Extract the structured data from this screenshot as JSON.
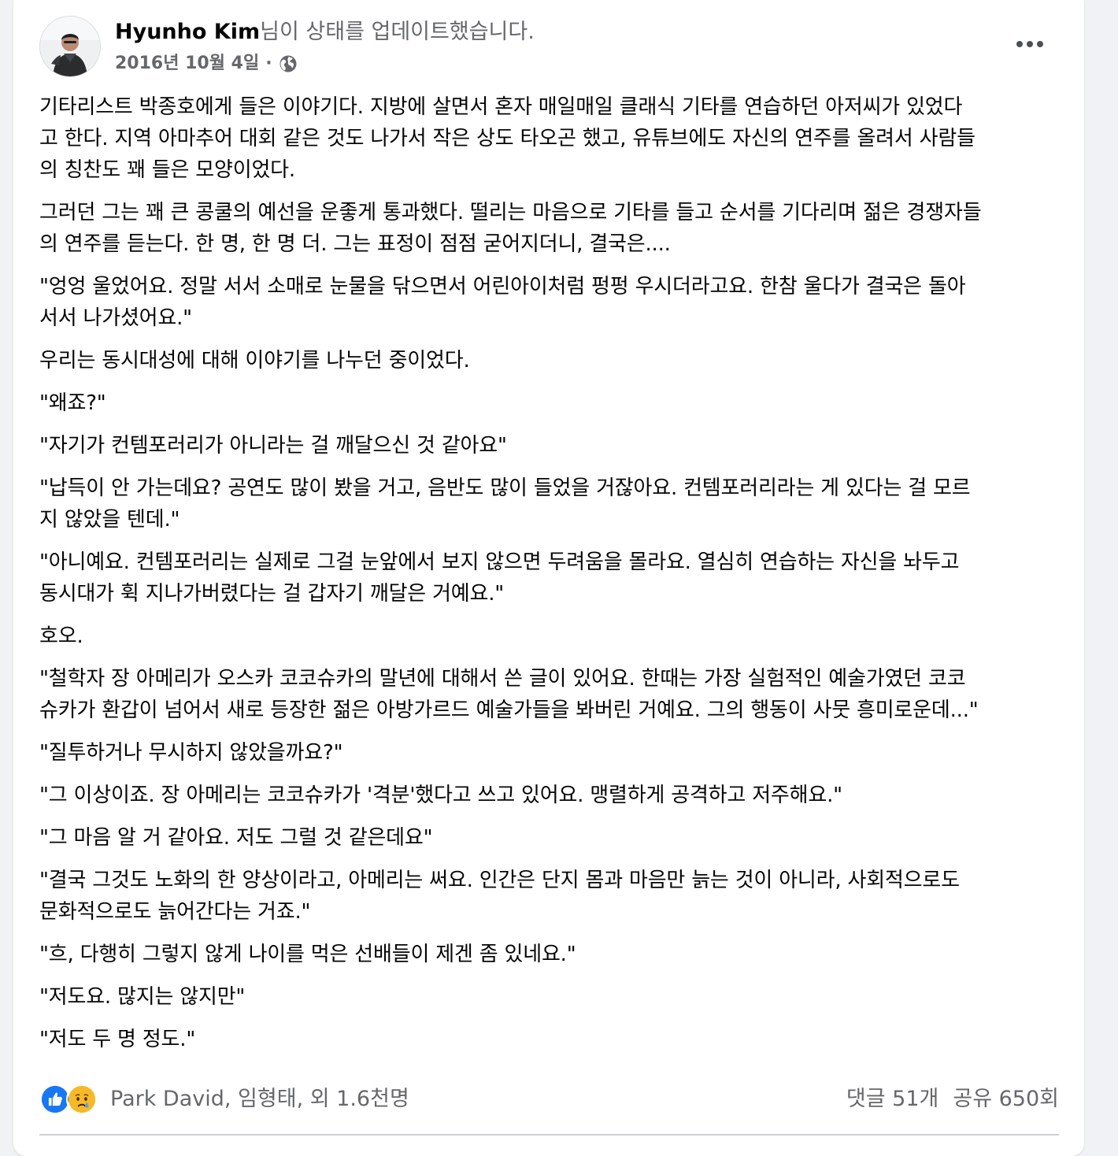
{
  "post": {
    "author": "Hyunho Kim",
    "action": "님이 상태를 업데이트했습니다.",
    "date": "2016년 10월 4일",
    "separator": "·",
    "privacy_icon": "globe-icon",
    "more_icon": "more-options-icon",
    "paragraphs": [
      [
        "기타리스트 박종호에게 들은 이야기다. 지방에 살면서 혼자 매일매일 클래식 기타를 연습하던 아저씨가 있었다",
        "고 한다. 지역 아마추어 대회 같은 것도 나가서 작은 상도 타오곤 했고, 유튜브에도 자신의 연주를 올려서 사람들",
        "의 칭찬도 꽤 들은 모양이었다."
      ],
      [
        "그러던 그는 꽤 큰 콩쿨의 예선을 운좋게 통과했다. 떨리는 마음으로 기타를 들고 순서를 기다리며 젊은 경쟁자들",
        "의 연주를 듣는다. 한 명, 한 명 더. 그는 표정이 점점 굳어지더니, 결국은...."
      ],
      [
        "\"엉엉 울었어요. 정말 서서 소매로 눈물을 닦으면서 어린아이처럼 펑펑 우시더라고요. 한참 울다가 결국은 돌아",
        "서서 나가셨어요.\""
      ],
      [
        "우리는 동시대성에 대해 이야기를 나누던 중이었다."
      ],
      [
        "\"왜죠?\""
      ],
      [
        "\"자기가 컨템포러리가 아니라는 걸 깨달으신 것 같아요\""
      ],
      [
        "\"납득이 안 가는데요? 공연도 많이 봤을 거고, 음반도 많이 들었을 거잖아요. 컨템포러리라는 게 있다는 걸 모르",
        "지 않았을 텐데.\""
      ],
      [
        "\"아니예요. 컨템포러리는 실제로 그걸 눈앞에서 보지 않으면 두려움을 몰라요. 열심히 연습하는 자신을 놔두고",
        "동시대가 휙 지나가버렸다는 걸 갑자기 깨달은 거예요.\""
      ],
      [
        "호오."
      ],
      [
        "\"철학자 장 아메리가 오스카 코코슈카의 말년에 대해서 쓴 글이 있어요. 한때는 가장 실험적인 예술가였던 코코",
        "슈카가 환갑이 넘어서 새로 등장한 젊은 아방가르드 예술가들을 봐버린 거예요. 그의 행동이 사뭇 흥미로운데...\""
      ],
      [
        "\"질투하거나 무시하지 않았을까요?\""
      ],
      [
        "\"그 이상이죠. 장 아메리는 코코슈카가 '격분'했다고 쓰고 있어요. 맹렬하게 공격하고 저주해요.\""
      ],
      [
        "\"그 마음 알 거 같아요. 저도 그럴 것 같은데요\""
      ],
      [
        "\"결국 그것도 노화의 한 양상이라고, 아메리는 써요. 인간은 단지 몸과 마음만 늙는 것이 아니라, 사회적으로도",
        "문화적으로도 늙어간다는 거죠.\""
      ],
      [
        "\"흐, 다행히 그렇지 않게 나이를 먹은 선배들이 제겐 좀 있네요.\""
      ],
      [
        "\"저도요. 많지는 않지만\""
      ],
      [
        "\"저도 두 명 정도.\""
      ]
    ]
  },
  "reactions": {
    "icons": [
      "like-reaction-icon",
      "sad-reaction-icon"
    ],
    "names": "Park David, 임형태, 외 1.6천명",
    "comments": "댓글 51개",
    "shares": "공유 650회"
  },
  "colors": {
    "like_blue": "#1877f2",
    "sad_yellow": "#f7b928",
    "secondary_text": "#65676b",
    "primary_text": "#050505"
  }
}
